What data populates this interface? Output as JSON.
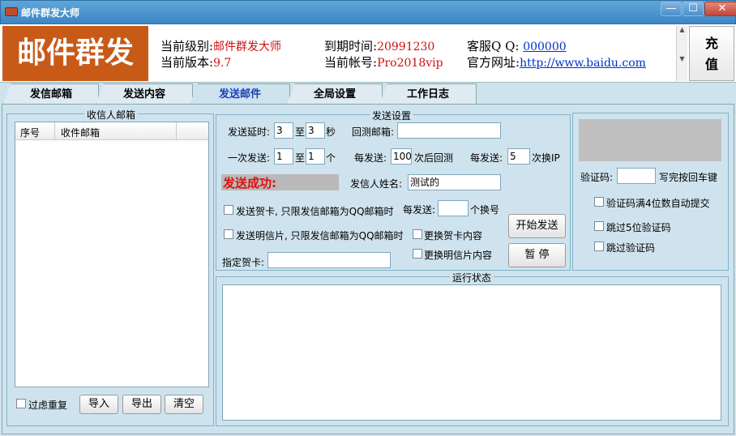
{
  "window": {
    "title": "邮件群发大师",
    "minimize": "—",
    "maximize": "☐",
    "close": "✕"
  },
  "header": {
    "brand": "邮件群发",
    "level_label": "当前级别:",
    "level_value": "邮件群发大师",
    "version_label": "当前版本:",
    "version_value": "9.7",
    "expire_label": "到期时间:",
    "expire_value": "20991230",
    "account_label": "当前帐号:",
    "account_value": "Pro2018vip",
    "qq_label": "客服Q Q:",
    "qq_value": "000000",
    "site_label": "官方网址:",
    "site_value": "http://www.baidu.com",
    "recharge_line1": "充",
    "recharge_line2": "值"
  },
  "tabs": [
    "发信邮箱",
    "发送内容",
    "发送邮件",
    "全局设置",
    "工作日志"
  ],
  "active_tab": "发送邮件",
  "recipients": {
    "legend": "收信人邮箱",
    "columns": [
      "序号",
      "收件邮箱"
    ],
    "dedupe_label": "过虑重复",
    "import": "导入",
    "export": "导出",
    "clear": "清空"
  },
  "send_settings": {
    "legend": "发送设置",
    "delay_label": "发送延时:",
    "delay_from": "3",
    "to1": "至",
    "delay_to": "3",
    "sec": "秒",
    "reply_label": "回测邮箱:",
    "reply_value": "",
    "batch_label": "一次发送:",
    "batch_from": "1",
    "to2": "至",
    "batch_to": "1",
    "unit": "个",
    "every_label": "每发送:",
    "every_value": "100",
    "every_suffix": "次后回测",
    "ip_label": "每发送:",
    "ip_value": "5",
    "ip_suffix": "次换IP",
    "status": "发送成功:",
    "sender_label": "发信人姓名:",
    "sender_value": "测试的",
    "card_label": "发送贺卡, 只限发信邮箱为QQ邮箱时",
    "postcard_label": "发送明信片, 只限发信邮箱为QQ邮箱时",
    "switch_label": "每发送:",
    "switch_value": "",
    "switch_suffix": "个换号",
    "change_card": "更换贺卡内容",
    "change_postcard": "更换明信片内容",
    "card_name_label": "指定贺卡:",
    "card_name_value": "",
    "start": "开始发送",
    "pause": "暂 停"
  },
  "captcha": {
    "code_label": "验证码:",
    "code_value": "",
    "enter_hint": "写完按回车键",
    "auto_submit": "验证码满4位数自动提交",
    "skip5": "跳过5位验证码",
    "skip": "跳过验证码"
  },
  "run_status": {
    "legend": "运行状态",
    "text": ""
  }
}
